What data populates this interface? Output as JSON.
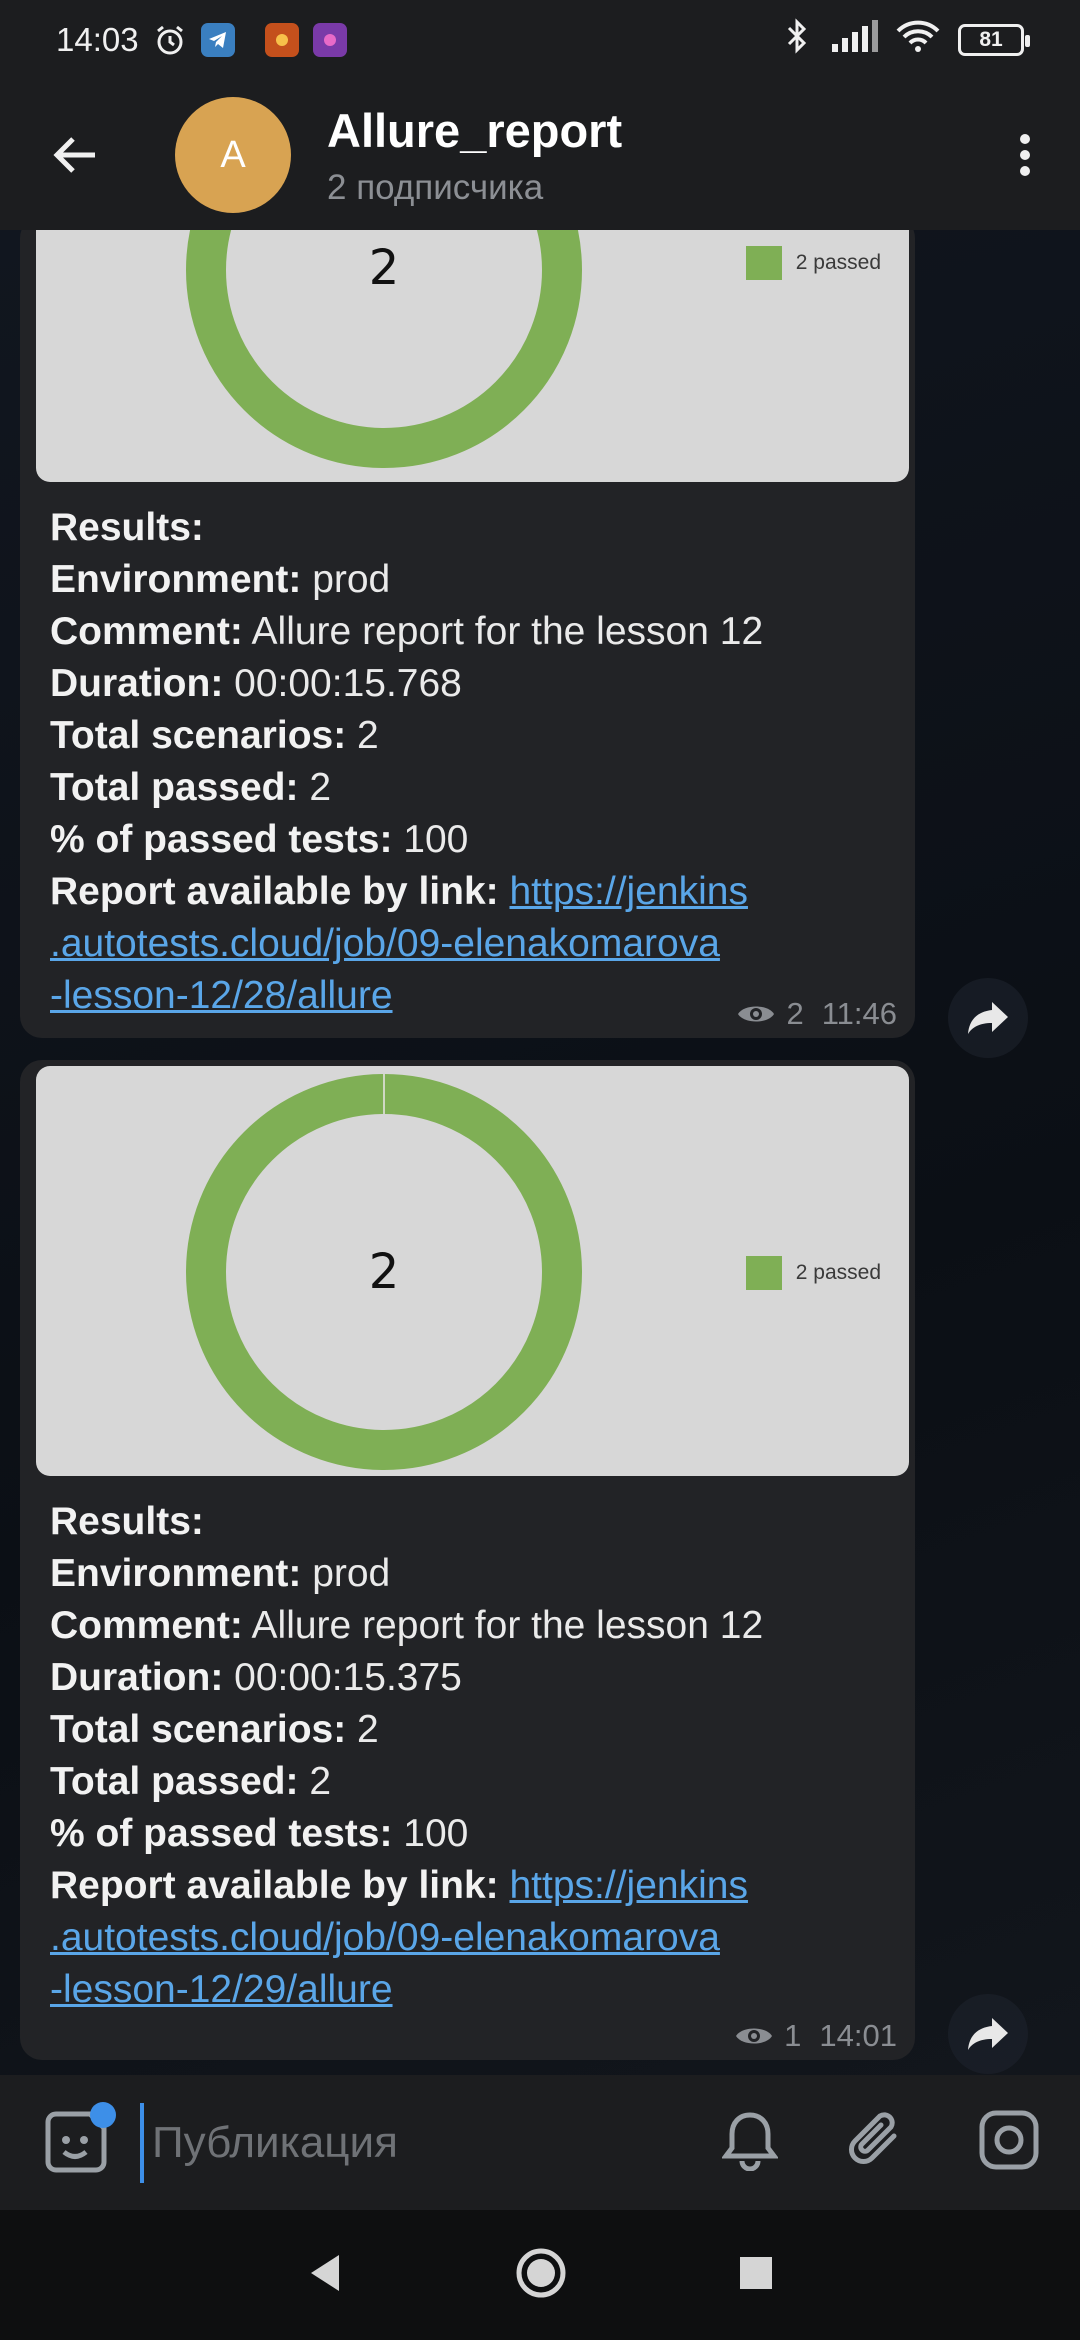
{
  "status_bar": {
    "time": "14:03",
    "battery": "81"
  },
  "header": {
    "avatar_letter": "A",
    "title": "Allure_report",
    "subtitle": "2 подписчика"
  },
  "messages": [
    {
      "chart_center": "2",
      "legend": "2 passed",
      "results_label": "Results:",
      "environment_label": "Environment:",
      "environment_value": " prod",
      "comment_label": "Comment:",
      "comment_value": " Allure report for the lesson 12",
      "duration_label": "Duration:",
      "duration_value": " 00:00:15.768",
      "total_scenarios_label": "Total scenarios:",
      "total_scenarios_value": " 2",
      "total_passed_label": "Total passed:",
      "total_passed_value": " 2",
      "percent_label": "% of passed tests:",
      "percent_value": " 100",
      "link_label": "Report available by link:",
      "link_line1": "https://jenkins",
      "link_line2": ".autotests.cloud/job/09-elenakomarova",
      "link_line3": "-lesson-12/28/allure",
      "views": "2",
      "time": "11:46"
    },
    {
      "chart_center": "2",
      "legend": "2 passed",
      "results_label": "Results:",
      "environment_label": "Environment:",
      "environment_value": " prod",
      "comment_label": "Comment:",
      "comment_value": " Allure report for the lesson 12",
      "duration_label": "Duration:",
      "duration_value": " 00:00:15.375",
      "total_scenarios_label": "Total scenarios:",
      "total_scenarios_value": " 2",
      "total_passed_label": "Total passed:",
      "total_passed_value": " 2",
      "percent_label": "% of passed tests:",
      "percent_value": " 100",
      "link_label": "Report available by link:",
      "link_line1": "https://jenkins",
      "link_line2": ".autotests.cloud/job/09-elenakomarova",
      "link_line3": "-lesson-12/29/allure",
      "views": "1",
      "time": "14:01"
    }
  ],
  "composer": {
    "placeholder": "Публикация"
  },
  "colors": {
    "accent": "#3d8fe8",
    "avatar": "#d8a352",
    "passed": "#7faf55",
    "link": "#5aa6e8"
  },
  "icons": {
    "status": [
      "alarm-icon",
      "telegram-icon",
      "app-icon",
      "app-icon-2",
      "bluetooth-icon",
      "signal-icon",
      "wifi-icon",
      "battery-icon"
    ],
    "header": [
      "back-arrow-icon",
      "more-vert-icon"
    ],
    "composer": [
      "sticker-icon",
      "bell-icon",
      "paperclip-icon",
      "instagram-icon"
    ],
    "nav": [
      "nav-back-icon",
      "nav-home-icon",
      "nav-recents-icon"
    ]
  }
}
